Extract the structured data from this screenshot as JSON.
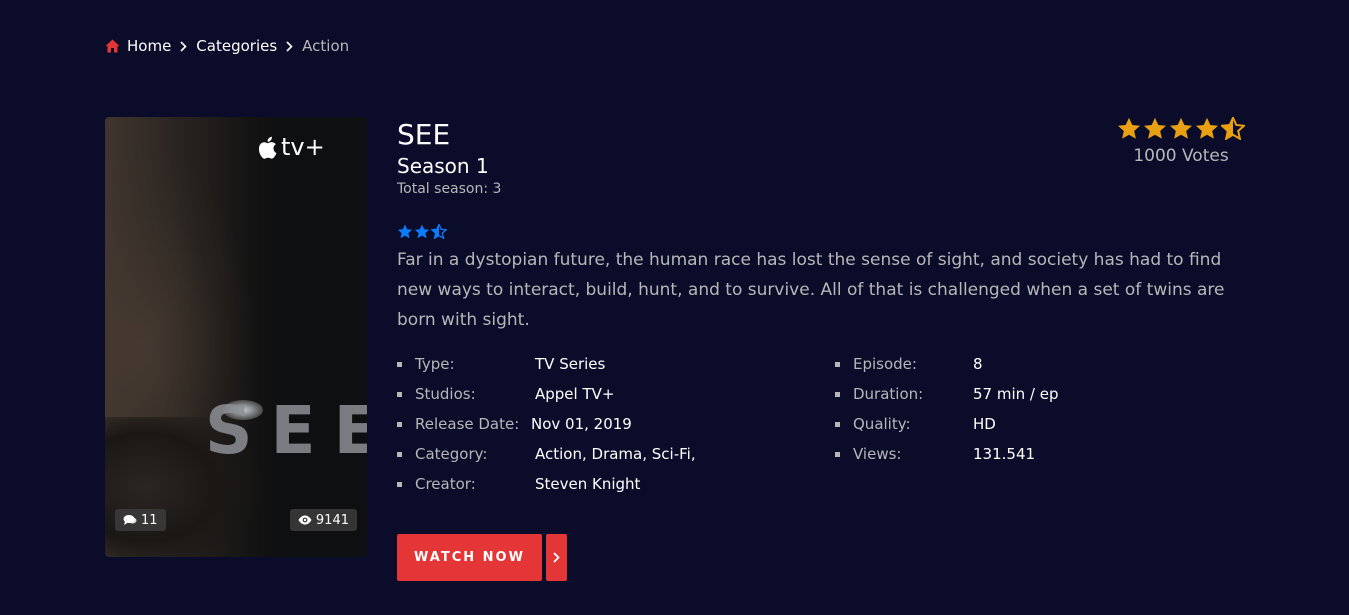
{
  "breadcrumb": {
    "items": [
      {
        "label": "Home"
      },
      {
        "label": "Categories"
      },
      {
        "label": "Action"
      }
    ]
  },
  "poster": {
    "brand": "tv+",
    "overlay_title": "SEE",
    "comments": "11",
    "views": "9141"
  },
  "anime": {
    "title": "SEE",
    "season": "Season 1",
    "total_season": "Total season: 3",
    "mini_rating_stars": 2.5,
    "rating_stars": 4.5,
    "votes": "1000 Votes",
    "description": "Far in a dystopian future, the human race has lost the sense of sight, and society has had to find new ways to interact, build, hunt, and to survive. All of that is challenged when a set of twins are born with sight."
  },
  "details_left": [
    {
      "label": "Type:",
      "value": "TV Series"
    },
    {
      "label": "Studios:",
      "value": "Appel TV+"
    },
    {
      "label": "Release Date:",
      "value": "Nov 01, 2019"
    },
    {
      "label": "Category:",
      "value": "Action, Drama, Sci-Fi,"
    },
    {
      "label": "Creator:",
      "value": "Steven Knight"
    }
  ],
  "details_right": [
    {
      "label": "Episode:",
      "value": "8"
    },
    {
      "label": "Duration:",
      "value": "57 min / ep"
    },
    {
      "label": "Quality:",
      "value": "HD"
    },
    {
      "label": "Views:",
      "value": "131.541"
    }
  ],
  "actions": {
    "watch_now": "WATCH NOW"
  },
  "colors": {
    "background": "#0b0c2a",
    "accent": "#e53637",
    "star_gold": "#e89f12",
    "star_blue": "#0b7bff",
    "muted": "#b7b7b7"
  },
  "icons": {
    "home": "home-icon",
    "separator": "chevron-right-icon",
    "comments": "comments-icon",
    "views": "eye-icon",
    "watch_arrow": "chevron-right-icon",
    "brand": "apple-icon"
  }
}
